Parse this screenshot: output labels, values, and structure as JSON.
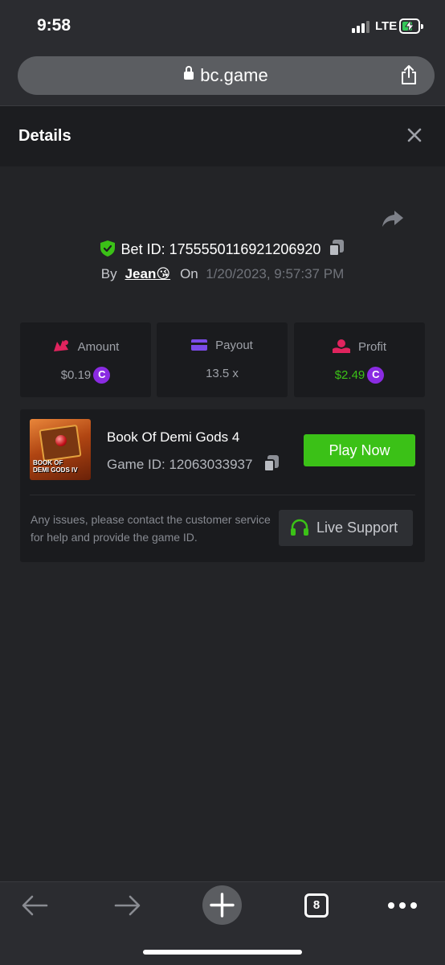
{
  "status_bar": {
    "time": "9:58",
    "network": "LTE"
  },
  "browser": {
    "url": "bc.game"
  },
  "details": {
    "title": "Details",
    "bet_id": "Bet ID: 1755550116921206920",
    "by_label": "By",
    "username": "Jean😘",
    "on_label": "On",
    "date": "1/20/2023, 9:57:37 PM"
  },
  "stats": {
    "amount": {
      "label": "Amount",
      "value": "$0.19"
    },
    "payout": {
      "label": "Payout",
      "value": "13.5 x"
    },
    "profit": {
      "label": "Profit",
      "value": "$2.49"
    }
  },
  "game": {
    "name": "Book Of Demi Gods 4",
    "game_id": "Game ID: 12063033937",
    "thumb_text": "BOOK OF\nDEMI GODS IV",
    "play_label": "Play Now",
    "support_text": "Any issues, please contact the customer service for help and provide the game ID.",
    "support_label": "Live Support"
  },
  "toolbar": {
    "tabs_count": "8"
  },
  "colors": {
    "accent_green": "#3bc117",
    "coin_purple": "#8a2be2",
    "shield_green": "#3bc117"
  }
}
